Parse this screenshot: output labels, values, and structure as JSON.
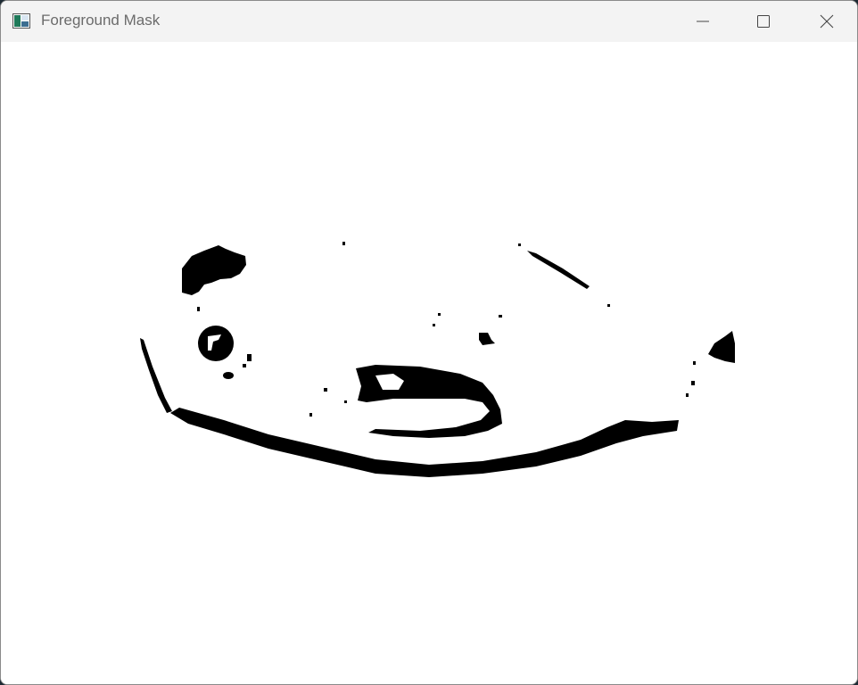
{
  "window": {
    "title": "Foreground Mask",
    "app_icon": "opencv-window-icon",
    "controls": {
      "minimize_icon": "minimize-icon",
      "maximize_icon": "maximize-icon",
      "close_icon": "close-icon"
    }
  },
  "image": {
    "description_kind": "binary-foreground-mask",
    "background_color": "#ffffff",
    "foreground_color": "#000000"
  }
}
